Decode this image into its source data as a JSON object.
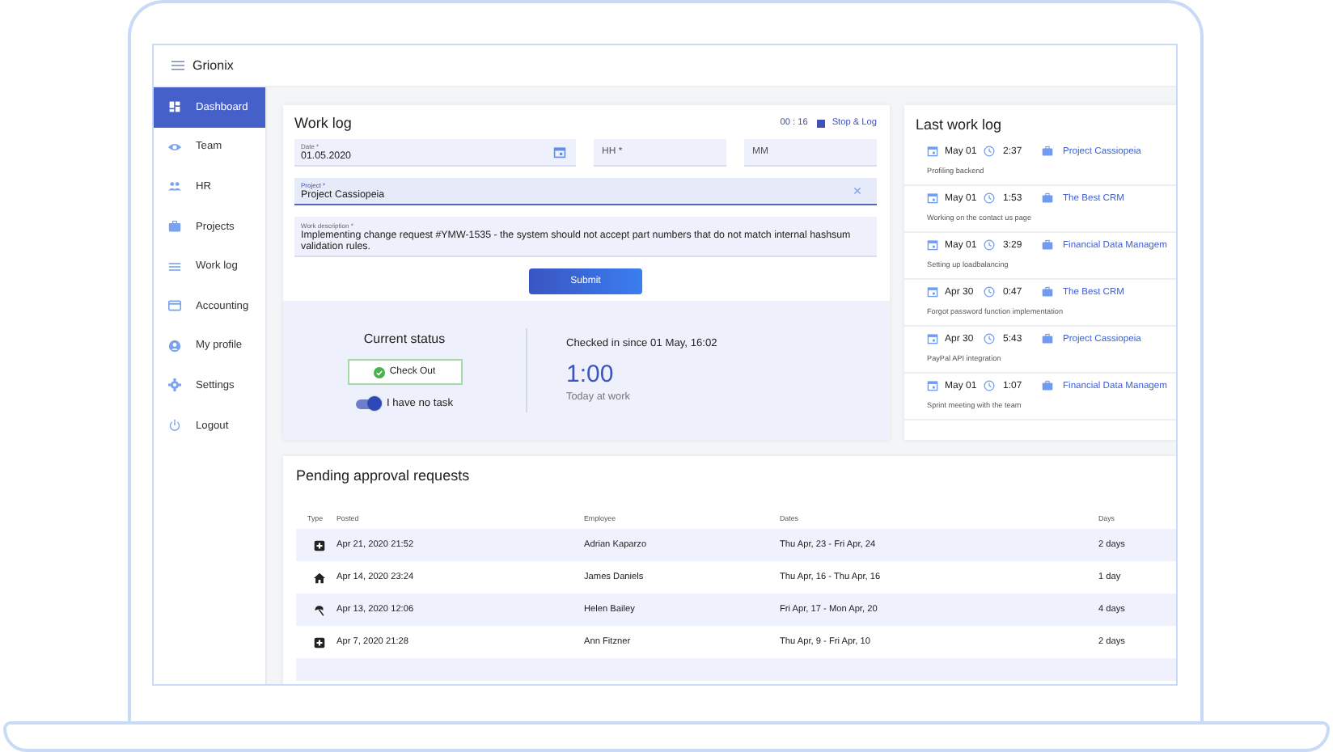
{
  "app": {
    "name": "Grionix"
  },
  "sidebar": {
    "items": [
      {
        "label": "Dashboard",
        "selected": true
      },
      {
        "label": "Team",
        "selected": false
      },
      {
        "label": "HR",
        "selected": false
      },
      {
        "label": "Projects",
        "selected": false
      },
      {
        "label": "Work log",
        "selected": false
      },
      {
        "label": "Accounting",
        "selected": false
      },
      {
        "label": "My profile",
        "selected": false
      },
      {
        "label": "Settings",
        "selected": false
      },
      {
        "label": "Logout",
        "selected": false
      }
    ]
  },
  "work_log": {
    "title": "Work log",
    "timer": "00 : 16",
    "stop_button": "Stop & Log",
    "date": {
      "label": "Date *",
      "value": "01.05.2020"
    },
    "hours": {
      "placeholder": "HH *"
    },
    "minutes": {
      "placeholder": "MM"
    },
    "project": {
      "label": "Project *",
      "value": "Project Cassiopeia"
    },
    "description": {
      "label": "Work description *",
      "value": "Implementing change request #YMW-1535 - the system should not accept part numbers that do not match internal hashsum validation rules."
    },
    "submit": "Submit",
    "status": {
      "title": "Current status",
      "check_out": "Check Out",
      "toggle": {
        "label": "I have no task",
        "on": true
      },
      "checked_in": "Checked in since 01 May, 16:02",
      "time": "1:00",
      "time_caption": "Today at work"
    }
  },
  "last_work_log": {
    "title": "Last work log",
    "entries": [
      {
        "date": "May 01",
        "duration": "2:37",
        "project": "Project Cassiopeia",
        "description": "Profiling backend"
      },
      {
        "date": "May 01",
        "duration": "1:53",
        "project": "The Best CRM",
        "description": "Working on the contact us page"
      },
      {
        "date": "May 01",
        "duration": "3:29",
        "project": "Financial Data Managem",
        "description": "Setting up loadbalancing"
      },
      {
        "date": "Apr 30",
        "duration": "0:47",
        "project": "The Best CRM",
        "description": "Forgot password function implementation"
      },
      {
        "date": "Apr 30",
        "duration": "5:43",
        "project": "Project Cassiopeia",
        "description": "PayPal API integration"
      },
      {
        "date": "May 01",
        "duration": "1:07",
        "project": "Financial Data Managem",
        "description": "Sprint meeting with the team"
      }
    ]
  },
  "pending": {
    "title": "Pending approval requests",
    "columns": [
      "Type",
      "Posted",
      "Employee",
      "Dates",
      "Days"
    ],
    "rows": [
      {
        "kind": "plus",
        "posted": "Apr 21, 2020 21:52",
        "employee": "Adrian Kaparzo",
        "dates": "Thu Apr, 23 - Fri Apr, 24",
        "days": "2 days"
      },
      {
        "kind": "home",
        "posted": "Apr 14, 2020 23:24",
        "employee": "James Daniels",
        "dates": "Thu Apr, 16 - Thu Apr, 16",
        "days": "1 day"
      },
      {
        "kind": "umbrella",
        "posted": "Apr 13, 2020 12:06",
        "employee": "Helen Bailey",
        "dates": "Fri Apr, 17 - Mon Apr, 20",
        "days": "4 days"
      },
      {
        "kind": "plus",
        "posted": "Apr 7, 2020 21:28",
        "employee": "Ann Fitzner",
        "dates": "Thu Apr, 9 - Fri Apr, 10",
        "days": "2 days"
      }
    ]
  }
}
